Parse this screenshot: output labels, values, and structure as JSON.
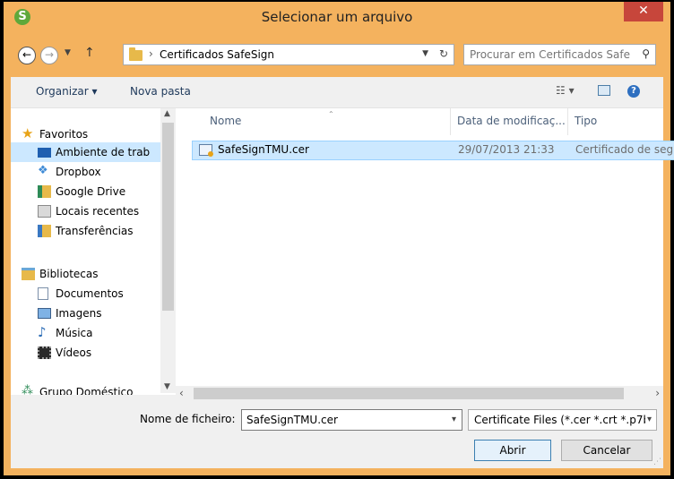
{
  "window": {
    "title": "Selecionar um arquivo"
  },
  "address": {
    "breadcrumb": "Certificados SafeSign",
    "search_placeholder": "Procurar em Certificados Safe..."
  },
  "toolbar": {
    "organize": "Organizar ▾",
    "new_folder": "Nova pasta"
  },
  "nav": {
    "favorites": "Favoritos",
    "favorites_items": [
      "Ambiente de trab",
      "Dropbox",
      "Google Drive",
      "Locais recentes",
      "Transferências"
    ],
    "libraries": "Bibliotecas",
    "libraries_items": [
      "Documentos",
      "Imagens",
      "Música",
      "Vídeos"
    ],
    "homegroup": "Grupo Doméstico"
  },
  "columns": {
    "name": "Nome",
    "date": "Data de modificaç...",
    "type": "Tipo"
  },
  "files": [
    {
      "name": "SafeSignTMU.cer",
      "date": "29/07/2013 21:33",
      "type": "Certificado de seg..."
    }
  ],
  "footer": {
    "filename_label": "Nome de ficheiro:",
    "filename_value": "SafeSignTMU.cer",
    "filter": "Certificate Files (*.cer *.crt *.p7b",
    "open_label": "Abrir",
    "cancel_label": "Cancelar"
  },
  "colors": {
    "accent": "#f4b25e",
    "close": "#c7463b",
    "selection": "#cce8ff"
  }
}
